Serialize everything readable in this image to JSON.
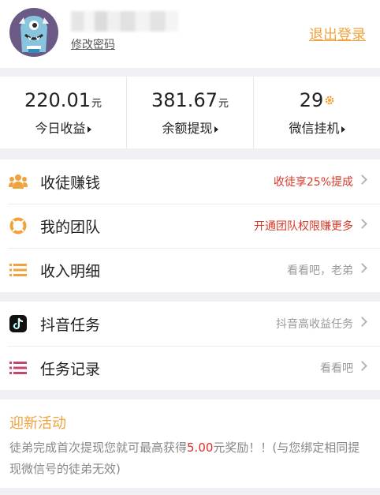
{
  "header": {
    "change_password": "修改密码",
    "logout": "退出登录"
  },
  "stats": [
    {
      "value": "220.01",
      "unit": "元",
      "label": "今日收益",
      "icon": "triangle-right"
    },
    {
      "value": "381.67",
      "unit": "元",
      "label": "余额提现",
      "icon": "triangle-right"
    },
    {
      "value": "29",
      "unit": "",
      "label": "微信挂机",
      "icon": "gear-icon"
    }
  ],
  "menu": [
    {
      "title": "收徒赚钱",
      "hint": "收徒享25%提成",
      "icon": "users-icon"
    },
    {
      "title": "我的团队",
      "hint": "开通团队权限赚更多",
      "icon": "lifebuoy-icon"
    },
    {
      "title": "收入明细",
      "hint": "看看吧，老弟",
      "icon": "list-icon"
    }
  ],
  "menu2": [
    {
      "title": "抖音任务",
      "hint": "抖音高收益任务",
      "icon": "tiktok-icon"
    },
    {
      "title": "任务记录",
      "hint": "看看吧",
      "icon": "list-icon"
    }
  ],
  "activity": {
    "title": "迎新活动",
    "text_before": "徒弟完成首次提现您就可最高获得",
    "amount": "5.00",
    "text_after": "元奖励！！(与您绑定相同提现微信号的徒弟无效)"
  },
  "colors": {
    "accent": "#f0a23c",
    "red": "#d63a2a",
    "tiktok": "#111111",
    "record": "#c8466e"
  }
}
